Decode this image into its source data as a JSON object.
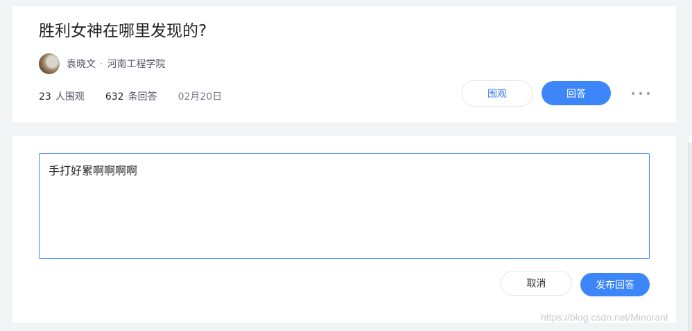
{
  "question": {
    "title": "胜利女神在哪里发现的?",
    "author_name": "袁晓文",
    "author_separator": "·",
    "author_school": "河南工程学院",
    "watch_count": "23",
    "watch_label": "人围观",
    "answer_count": "632",
    "answer_label": "条回答",
    "date": "02月20日",
    "watch_button": "围观",
    "answer_button": "回答"
  },
  "answer_form": {
    "text": "手打好累啊啊啊啊",
    "cancel_button": "取消",
    "publish_button": "发布回答"
  },
  "watermark": "https://blog.csdn.net/Minorant",
  "colors": {
    "accent": "#3d86fa",
    "background": "#f2f3f5"
  }
}
